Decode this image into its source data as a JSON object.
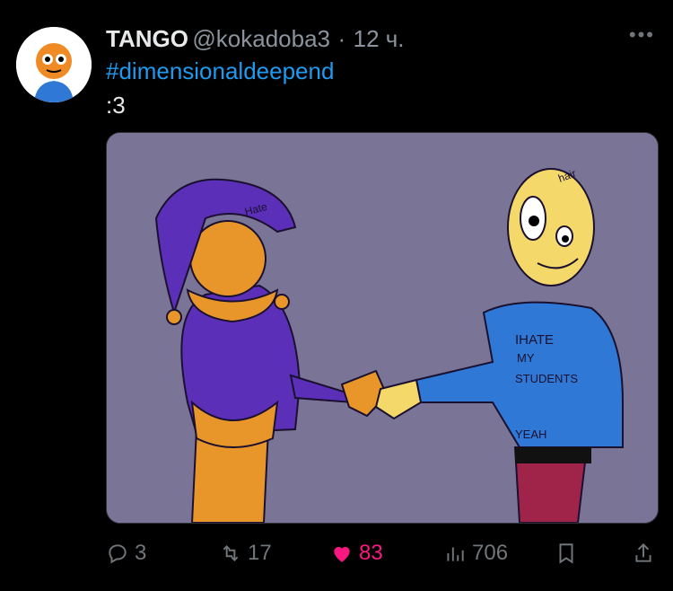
{
  "tweet": {
    "display_name": "TANGO",
    "handle": "@kokadoba3",
    "separator": "·",
    "time": "12 ч.",
    "more_label": "•••",
    "hashtag": "#dimensionaldeepend",
    "text": ":3"
  },
  "media": {
    "drawing_text": {
      "hat_left": "Hate",
      "hair_label": "hair",
      "shirt_line1": "IHATE",
      "shirt_line2": "MY",
      "shirt_line3": "STUDENTS",
      "shirt_line4": "YEAH"
    },
    "colors": {
      "background": "#7a7496",
      "jester_purple": "#5b2fb8",
      "jester_orange": "#e8952a",
      "shirt_blue": "#2f78d6",
      "pants_red": "#a0234a"
    }
  },
  "actions": {
    "replies": "3",
    "retweets": "17",
    "likes": "83",
    "views": "706"
  },
  "colors": {
    "link": "#1d9bf0",
    "like": "#f91880",
    "muted": "#71767b"
  }
}
